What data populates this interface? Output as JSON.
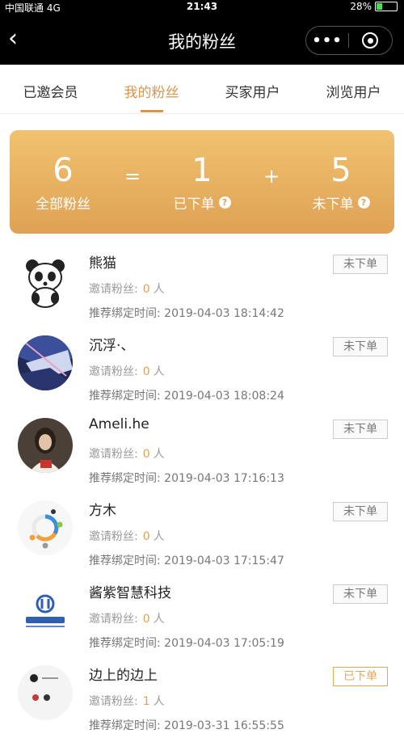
{
  "status_bar": {
    "carrier": "中国联通 4G",
    "time": "21:43",
    "battery": "28%",
    "battery_level": 0.28
  },
  "nav": {
    "title": "我的粉丝",
    "back_icon": "chevron-left-icon",
    "more_icon": "more-dots-icon",
    "close_icon": "target-icon"
  },
  "tabs": [
    {
      "label": "已邀会员",
      "active": false
    },
    {
      "label": "我的粉丝",
      "active": true
    },
    {
      "label": "买家用户",
      "active": false
    },
    {
      "label": "浏览用户",
      "active": false
    }
  ],
  "summary": {
    "total": {
      "value": "6",
      "label": "全部粉丝"
    },
    "equals": "=",
    "ordered": {
      "value": "1",
      "label": "已下单"
    },
    "plus": "+",
    "not_ordered": {
      "value": "5",
      "label": "未下单"
    },
    "help_glyph": "?",
    "accent": "#dfa155"
  },
  "labels": {
    "invite_prefix": "邀请粉丝:",
    "invite_unit": "人",
    "bind_prefix": "推荐绑定时间:"
  },
  "fans": [
    {
      "name": "熊猫",
      "invite_count": "0",
      "bind_time": "2019-04-03 18:14:42",
      "status": "未下单",
      "avatar": "panda-avatar"
    },
    {
      "name": "沉浮·、",
      "invite_count": "0",
      "bind_time": "2019-04-03 18:08:24",
      "status": "未下单",
      "avatar": "landscape-avatar"
    },
    {
      "name": "Ameli.he",
      "invite_count": "0",
      "bind_time": "2019-04-03 17:16:13",
      "status": "未下单",
      "avatar": "photo-avatar"
    },
    {
      "name": "方木",
      "invite_count": "0",
      "bind_time": "2019-04-03 17:15:47",
      "status": "未下单",
      "avatar": "circle-logo-avatar"
    },
    {
      "name": "酱紫智慧科技",
      "invite_count": "0",
      "bind_time": "2019-04-03 17:05:19",
      "status": "未下单",
      "avatar": "company-logo-avatar"
    },
    {
      "name": "边上的边上",
      "invite_count": "1",
      "bind_time": "2019-03-31 16:55:55",
      "status": "已下单",
      "avatar": "sketch-avatar"
    }
  ]
}
